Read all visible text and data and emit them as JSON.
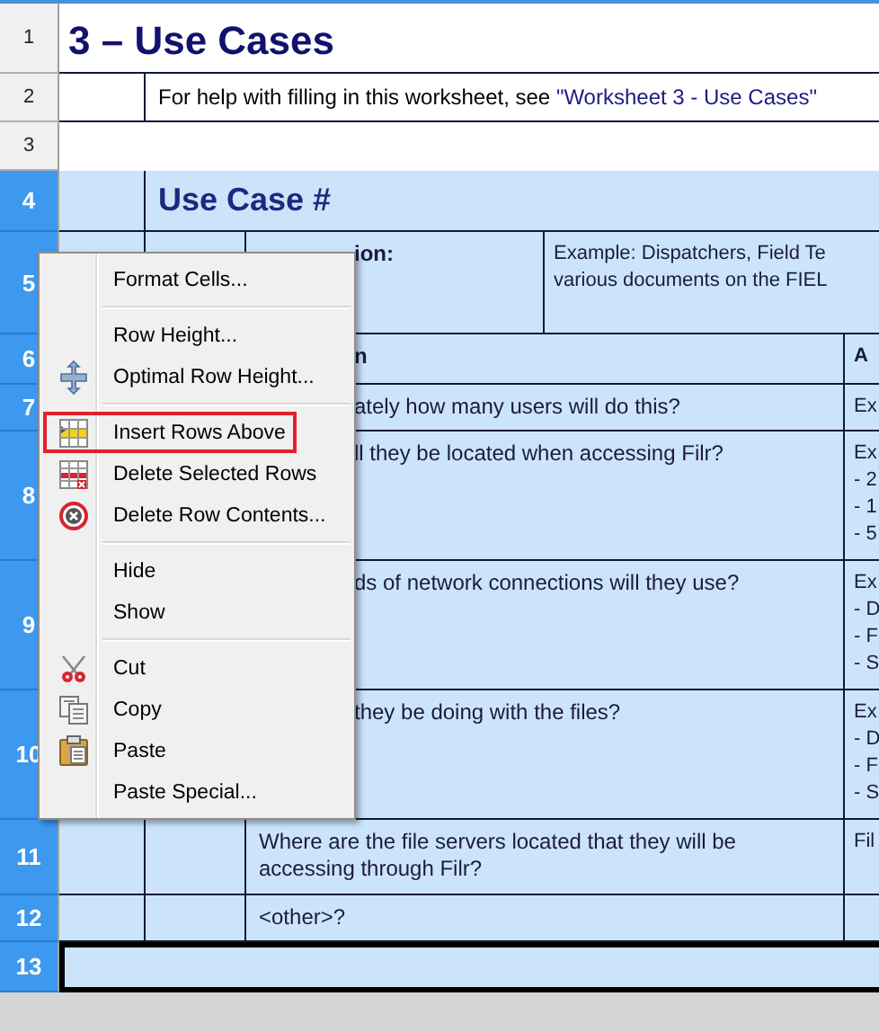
{
  "sheet": {
    "rows": [
      {
        "number": "1",
        "selected": false,
        "kind": "title",
        "title": "3 – Use Cases"
      },
      {
        "number": "2",
        "selected": false,
        "kind": "note",
        "text": "For help with filling in this worksheet, see ",
        "link": "\"Worksheet 3 - Use Cases\""
      },
      {
        "number": "3",
        "selected": false,
        "kind": "blank"
      },
      {
        "number": "4",
        "selected": true,
        "kind": "heading",
        "title": "Use Case #"
      },
      {
        "number": "5",
        "selected": true,
        "kind": "description",
        "column_3": "ion:",
        "column_4": [
          "Example: Dispatchers, Field Te",
          "various documents on the FIEL"
        ]
      },
      {
        "number": "6",
        "selected": true,
        "kind": "header",
        "column_3": "n",
        "column_4": [
          "A"
        ]
      },
      {
        "number": "7",
        "selected": true,
        "kind": "question",
        "covered": true,
        "column_3": "ately how many users will do this?",
        "column_4": [
          "Ex"
        ]
      },
      {
        "number": "8",
        "selected": true,
        "kind": "question",
        "covered": true,
        "column_3": "ll they be located when accessing Filr?",
        "column_4": [
          "Ex",
          "- 2",
          "- 1",
          "- 5"
        ]
      },
      {
        "number": "9",
        "selected": true,
        "kind": "question",
        "covered": true,
        "column_3": "ds of network connections will they use?",
        "column_4": [
          "Ex",
          "- D",
          "- F",
          "- S"
        ]
      },
      {
        "number": "10",
        "selected": true,
        "kind": "question",
        "covered": true,
        "column_3": "they be doing with the files?",
        "column_4": [
          "Ex",
          "- D",
          "- F",
          "- S"
        ]
      },
      {
        "number": "11",
        "selected": true,
        "kind": "question",
        "covered": false,
        "column_3": "Where are the file servers located that they will be accessing through Filr?",
        "column_4": [
          "Fil"
        ]
      },
      {
        "number": "12",
        "selected": true,
        "kind": "question",
        "covered": false,
        "column_3": "<other>?"
      },
      {
        "number": "13",
        "selected": true,
        "kind": "total"
      }
    ]
  },
  "context_menu": {
    "items": [
      {
        "kind": "item",
        "label": "Format Cells...",
        "selected": false
      },
      {
        "kind": "separator"
      },
      {
        "kind": "item",
        "label": "Row Height...",
        "selected": false
      },
      {
        "kind": "item",
        "label": "Optimal Row Height...",
        "selected": false
      },
      {
        "kind": "separator"
      },
      {
        "kind": "item",
        "label": "Insert Rows Above",
        "selected": true
      },
      {
        "kind": "item",
        "label": "Delete Selected Rows",
        "selected": false
      },
      {
        "kind": "item",
        "label": "Delete Row Contents...",
        "selected": false
      },
      {
        "kind": "separator"
      },
      {
        "kind": "item",
        "label": "Hide",
        "selected": false
      },
      {
        "kind": "item",
        "label": "Show",
        "selected": false
      },
      {
        "kind": "separator"
      },
      {
        "kind": "item",
        "label": "Cut",
        "selected": false
      },
      {
        "kind": "item",
        "label": "Copy",
        "selected": false
      },
      {
        "kind": "item",
        "label": "Paste",
        "selected": false
      },
      {
        "kind": "item",
        "label": "Paste Special...",
        "selected": false
      }
    ]
  }
}
